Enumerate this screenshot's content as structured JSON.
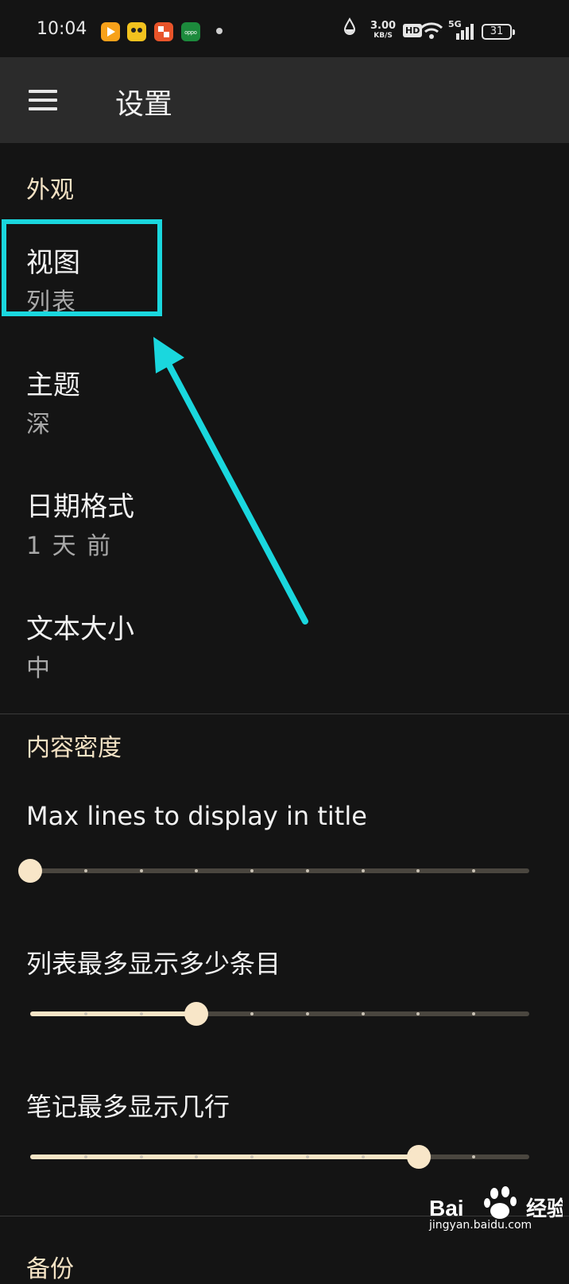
{
  "status_bar": {
    "time": "10:04",
    "net_speed": "3.00",
    "net_unit": "KB/S",
    "hd_label": "HD",
    "signal_label": "5G",
    "battery": "31"
  },
  "toolbar": {
    "title": "设置"
  },
  "sections": [
    {
      "header": "外观",
      "items": [
        {
          "title": "视图",
          "summary": "列表"
        },
        {
          "title": "主题",
          "summary": "深"
        },
        {
          "title": "日期格式",
          "summary": "1 天 前"
        },
        {
          "title": "文本大小",
          "summary": "中"
        }
      ]
    },
    {
      "header": "内容密度",
      "sliders": [
        {
          "title": "Max lines to display in title",
          "level_fraction": 0.0
        },
        {
          "title": "列表最多显示多少条目",
          "level_fraction": 0.333
        },
        {
          "title": "笔记最多显示几行",
          "level_fraction": 0.778
        }
      ]
    },
    {
      "header": "备份"
    }
  ],
  "watermark": {
    "brand": "Bai du 经验",
    "url": "jingyan.baidu.com"
  },
  "colors": {
    "background": "#141414",
    "toolbar": "#2b2b2b",
    "accent": "#f6e5c6",
    "annotation": "#1ad7de"
  }
}
